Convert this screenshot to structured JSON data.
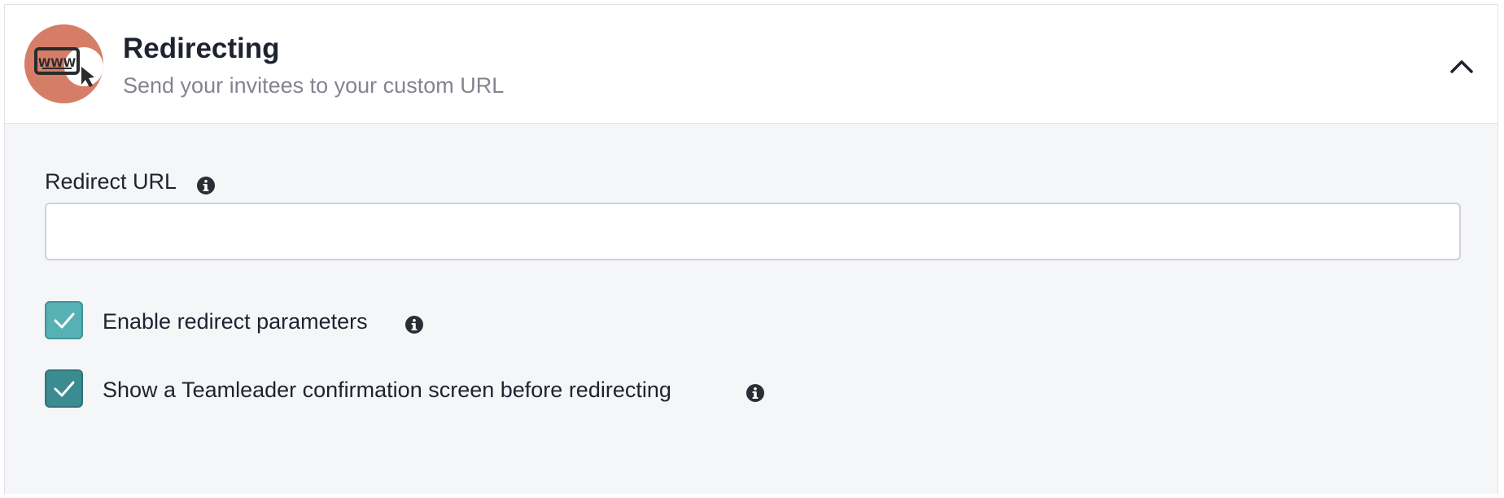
{
  "section": {
    "title": "Redirecting",
    "subtitle": "Send your invitees to your custom URL",
    "icon": "www-browser-cursor-icon",
    "icon_color": "#d67d68",
    "expanded": true
  },
  "redirect_url": {
    "label": "Redirect URL",
    "value": "",
    "placeholder": ""
  },
  "options": [
    {
      "label": "Enable redirect parameters",
      "checked": true,
      "color": "#56b1b5"
    },
    {
      "label": "Show a Teamleader confirmation screen before redirecting",
      "checked": true,
      "color": "#3b8c90"
    }
  ],
  "colors": {
    "panel_background": "#f5f6f8",
    "text": "#1f2330",
    "muted_text": "#828591"
  }
}
